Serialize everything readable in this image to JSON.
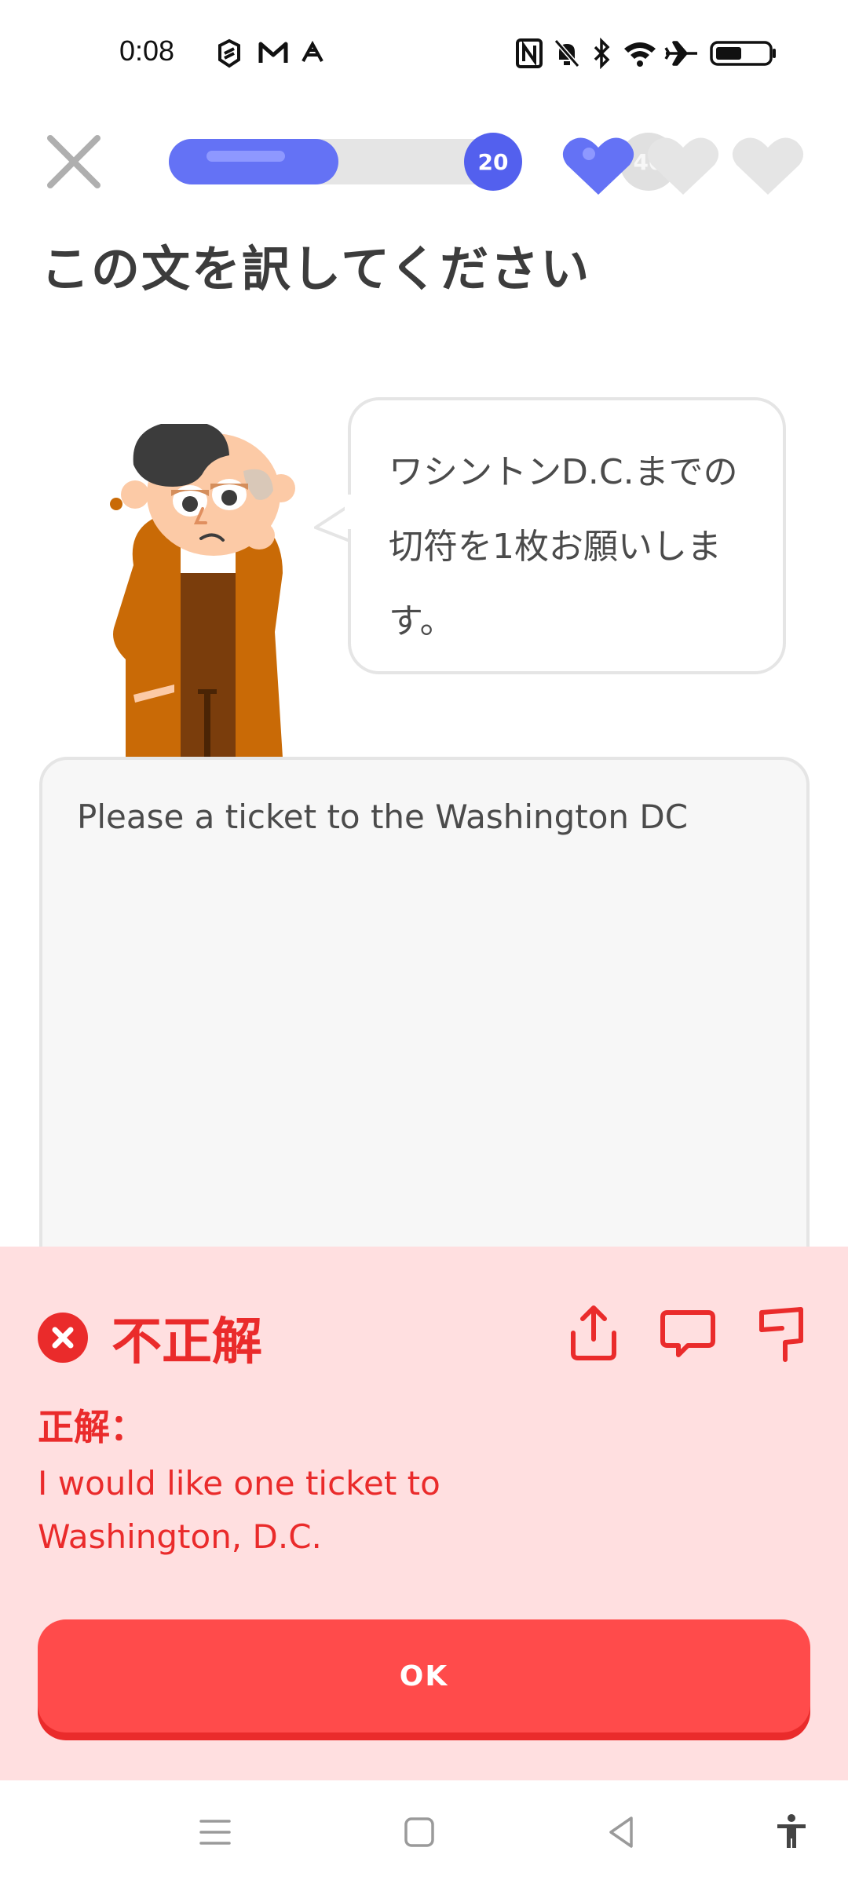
{
  "status_bar": {
    "time": "0:08",
    "left_icons": [
      "sync-app-icon",
      "gmail-icon",
      "app-notification-icon"
    ],
    "right_icons": [
      "nfc-icon",
      "mute-icon",
      "bluetooth-icon",
      "wifi-icon",
      "airplane-icon",
      "battery-icon"
    ]
  },
  "header": {
    "close_icon": "close-icon",
    "progress": {
      "current": "20",
      "goal": "40",
      "fraction": 0.5
    },
    "hearts": {
      "filled": 1,
      "total": 3
    }
  },
  "instruction": "この文を訳してください",
  "prompt_sentence": "ワシントンD.C.までの切符を1枚お願いします。",
  "prompt_lines": [
    "ワシントンD.C.までの",
    "切符を1枚お願いしま",
    "す。"
  ],
  "answer_input": "Please a ticket to the Washington DC",
  "feedback": {
    "status": "不正解",
    "label": "正解：",
    "correct_answer_lines": [
      "I would like one ticket to",
      "Washington, D.C."
    ],
    "actions": [
      "share-icon",
      "comment-icon",
      "report-flag-icon"
    ],
    "ok_label": "OK"
  },
  "colors": {
    "accent": "#6472f5",
    "error": "#ea2b2b",
    "error_bg": "#ffdfe0",
    "button": "#ff4b4b"
  },
  "nav_bar": [
    "menu-icon",
    "home-icon",
    "back-icon",
    "accessibility-icon"
  ]
}
